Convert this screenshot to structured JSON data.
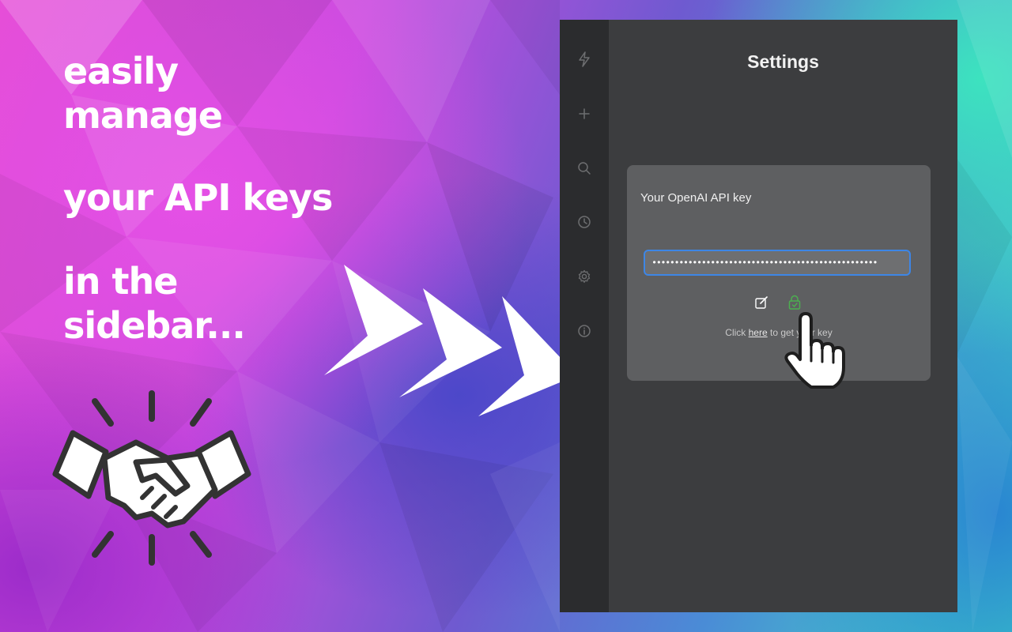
{
  "promo": {
    "line1": "easily",
    "line2": "manage",
    "line3": "your API keys",
    "line4": "in the",
    "line5": "sidebar..."
  },
  "sidebar": {
    "icons": [
      "lightning-icon",
      "plus-icon",
      "search-icon",
      "clock-icon",
      "gear-icon",
      "info-icon"
    ]
  },
  "settings": {
    "title": "Settings",
    "api_key_label": "Your OpenAI API key",
    "api_key_value": "••••••••••••••••••••••••••••••••••••••••••••••••••",
    "hint_prefix": "Click ",
    "hint_link": "here",
    "hint_suffix": " to get your key"
  },
  "colors": {
    "window_bg": "#3c3d3f",
    "rail_bg": "#2b2c2e",
    "card_bg": "#5e5f61",
    "input_border": "#3d86e6",
    "save_icon": "#4caf50"
  }
}
